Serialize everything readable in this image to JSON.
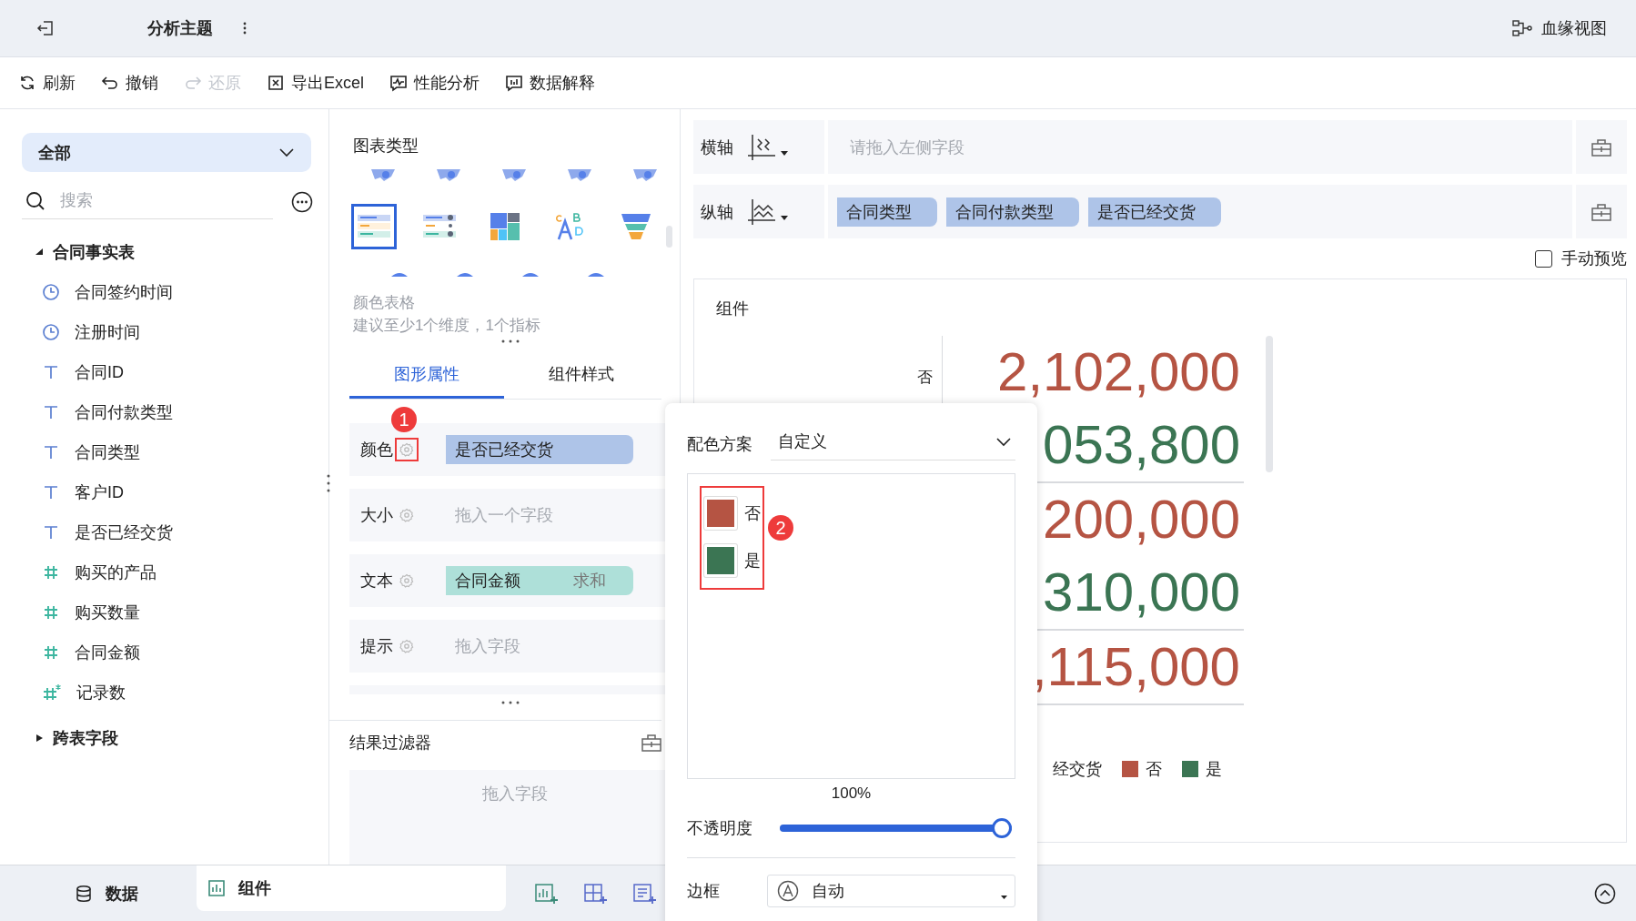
{
  "header": {
    "title": "分析主题",
    "lineage": "血缘视图"
  },
  "toolbar": [
    {
      "kind": "refresh",
      "label": "刷新",
      "disabled": false
    },
    {
      "kind": "undo",
      "label": "撤销",
      "disabled": false
    },
    {
      "kind": "redo",
      "label": "还原",
      "disabled": true
    },
    {
      "kind": "excel",
      "label": "导出Excel",
      "disabled": false
    },
    {
      "kind": "perf",
      "label": "性能分析",
      "disabled": false
    },
    {
      "kind": "explain",
      "label": "数据解释",
      "disabled": false
    }
  ],
  "sidebar": {
    "scope": "全部",
    "search": {
      "placeholder": "搜索"
    },
    "tree": [
      {
        "label": "合同事实表",
        "expanded": true,
        "children": [
          {
            "kind": "time",
            "label": "合同签约时间"
          },
          {
            "kind": "time",
            "label": "注册时间"
          },
          {
            "kind": "text",
            "label": "合同ID"
          },
          {
            "kind": "text",
            "label": "合同付款类型"
          },
          {
            "kind": "text",
            "label": "合同类型"
          },
          {
            "kind": "text",
            "label": "客户ID"
          },
          {
            "kind": "text",
            "label": "是否已经交货"
          },
          {
            "kind": "number",
            "label": "购买的产品"
          },
          {
            "kind": "number",
            "label": "购买数量"
          },
          {
            "kind": "number",
            "label": "合同金额"
          },
          {
            "kind": "calc",
            "label": "记录数"
          }
        ]
      },
      {
        "label": "跨表字段",
        "expanded": false
      }
    ]
  },
  "chart_panel": {
    "title": "图表类型",
    "chart_types": [
      {
        "kind": "color-table",
        "selected": true
      },
      {
        "kind": "dot-table",
        "selected": false
      },
      {
        "kind": "treemap",
        "selected": false
      },
      {
        "kind": "word-cloud",
        "selected": false
      },
      {
        "kind": "funnel",
        "selected": false
      }
    ],
    "type_name": "颜色表格",
    "hint": "建议至少1个维度，1个指标",
    "tabs": [
      {
        "label": "图形属性",
        "selected": true
      },
      {
        "label": "组件样式",
        "selected": false
      }
    ],
    "properties": [
      {
        "label": "颜色",
        "annotation": "1",
        "field": {
          "kind": "dimension",
          "name": "是否已经交货"
        }
      },
      {
        "label": "大小",
        "placeholder": "拖入一个字段"
      },
      {
        "label": "文本",
        "field": {
          "kind": "measure",
          "name": "合同金额",
          "aggregation": "求和"
        }
      },
      {
        "label": "提示",
        "placeholder": "拖入字段"
      }
    ],
    "filter": {
      "title": "结果过滤器",
      "placeholder": "拖入字段"
    }
  },
  "axes": [
    {
      "label": "横轴",
      "kind": "x",
      "placeholder": "请拖入左侧字段"
    },
    {
      "label": "纵轴",
      "kind": "y",
      "fields": [
        "合同类型",
        "合同付款类型",
        "是否已经交货"
      ]
    }
  ],
  "manual_preview": {
    "label": "手动预览",
    "checked": false
  },
  "widget": {
    "title": "组件",
    "groups": [
      {
        "label": "否",
        "rows": [
          {
            "value": "2,102,000",
            "color": "#b55443"
          },
          {
            "value": "053,800",
            "color": "#3b7553"
          }
        ]
      },
      {
        "rows": [
          {
            "value": "200,000",
            "color": "#b55443"
          },
          {
            "value": "310,000",
            "color": "#3b7553"
          }
        ]
      },
      {
        "rows": [
          {
            "value": ",115,000",
            "color": "#b55443"
          }
        ]
      }
    ],
    "legend": {
      "title": "经交货",
      "items": [
        {
          "label": "否",
          "color": "#b55443"
        },
        {
          "label": "是",
          "color": "#3b7553"
        }
      ]
    }
  },
  "popup": {
    "scheme_label": "配色方案",
    "scheme": "自定义",
    "annotation": "2",
    "colors": [
      {
        "label": "否",
        "color": "#b55443"
      },
      {
        "label": "是",
        "color": "#3b7553"
      }
    ],
    "opacity_reading": "100%",
    "opacity_label": "不透明度",
    "opacity": {
      "level": 1
    },
    "border_label": "边框",
    "border": "自动"
  },
  "bottom_tabs": [
    {
      "kind": "data",
      "label": "数据",
      "selected": false
    },
    {
      "kind": "widget",
      "label": "组件",
      "selected": true
    }
  ]
}
